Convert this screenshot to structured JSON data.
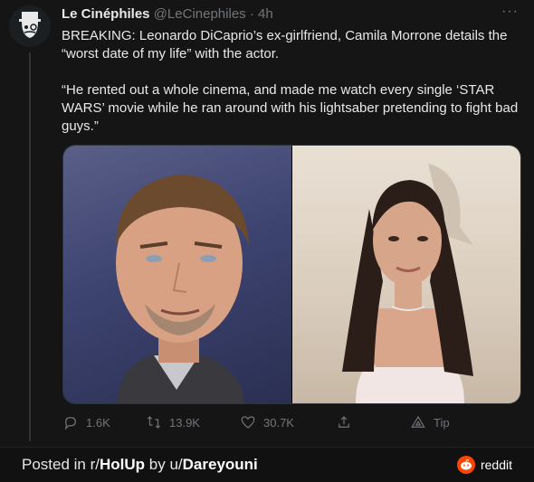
{
  "tweet": {
    "author_name": "Le Cinéphiles",
    "handle": "@LeCinephiles",
    "separator": "·",
    "time": "4h",
    "more_label": "···",
    "paragraph1": "BREAKING: Leonardo DiCaprio’s ex-girlfriend, Camila Morrone details the “worst date of my life” with the actor.",
    "paragraph2": "“He rented out a whole cinema, and made me watch every single ‘STAR WARS’ movie while he ran around with his lightsaber pretending to fight bad guys.”",
    "actions": {
      "replies": "1.6K",
      "retweets": "13.9K",
      "likes": "30.7K",
      "tip": "Tip"
    },
    "colors": {
      "background": "#151515",
      "text": "#e7e9ea",
      "muted": "#71767b"
    }
  },
  "footer": {
    "posted_prefix": "Posted in r/",
    "subreddit": "HolUp",
    "by_prefix": " by u/",
    "username": "Dareyouni",
    "brand": "reddit",
    "brand_color": "#ff4500"
  }
}
